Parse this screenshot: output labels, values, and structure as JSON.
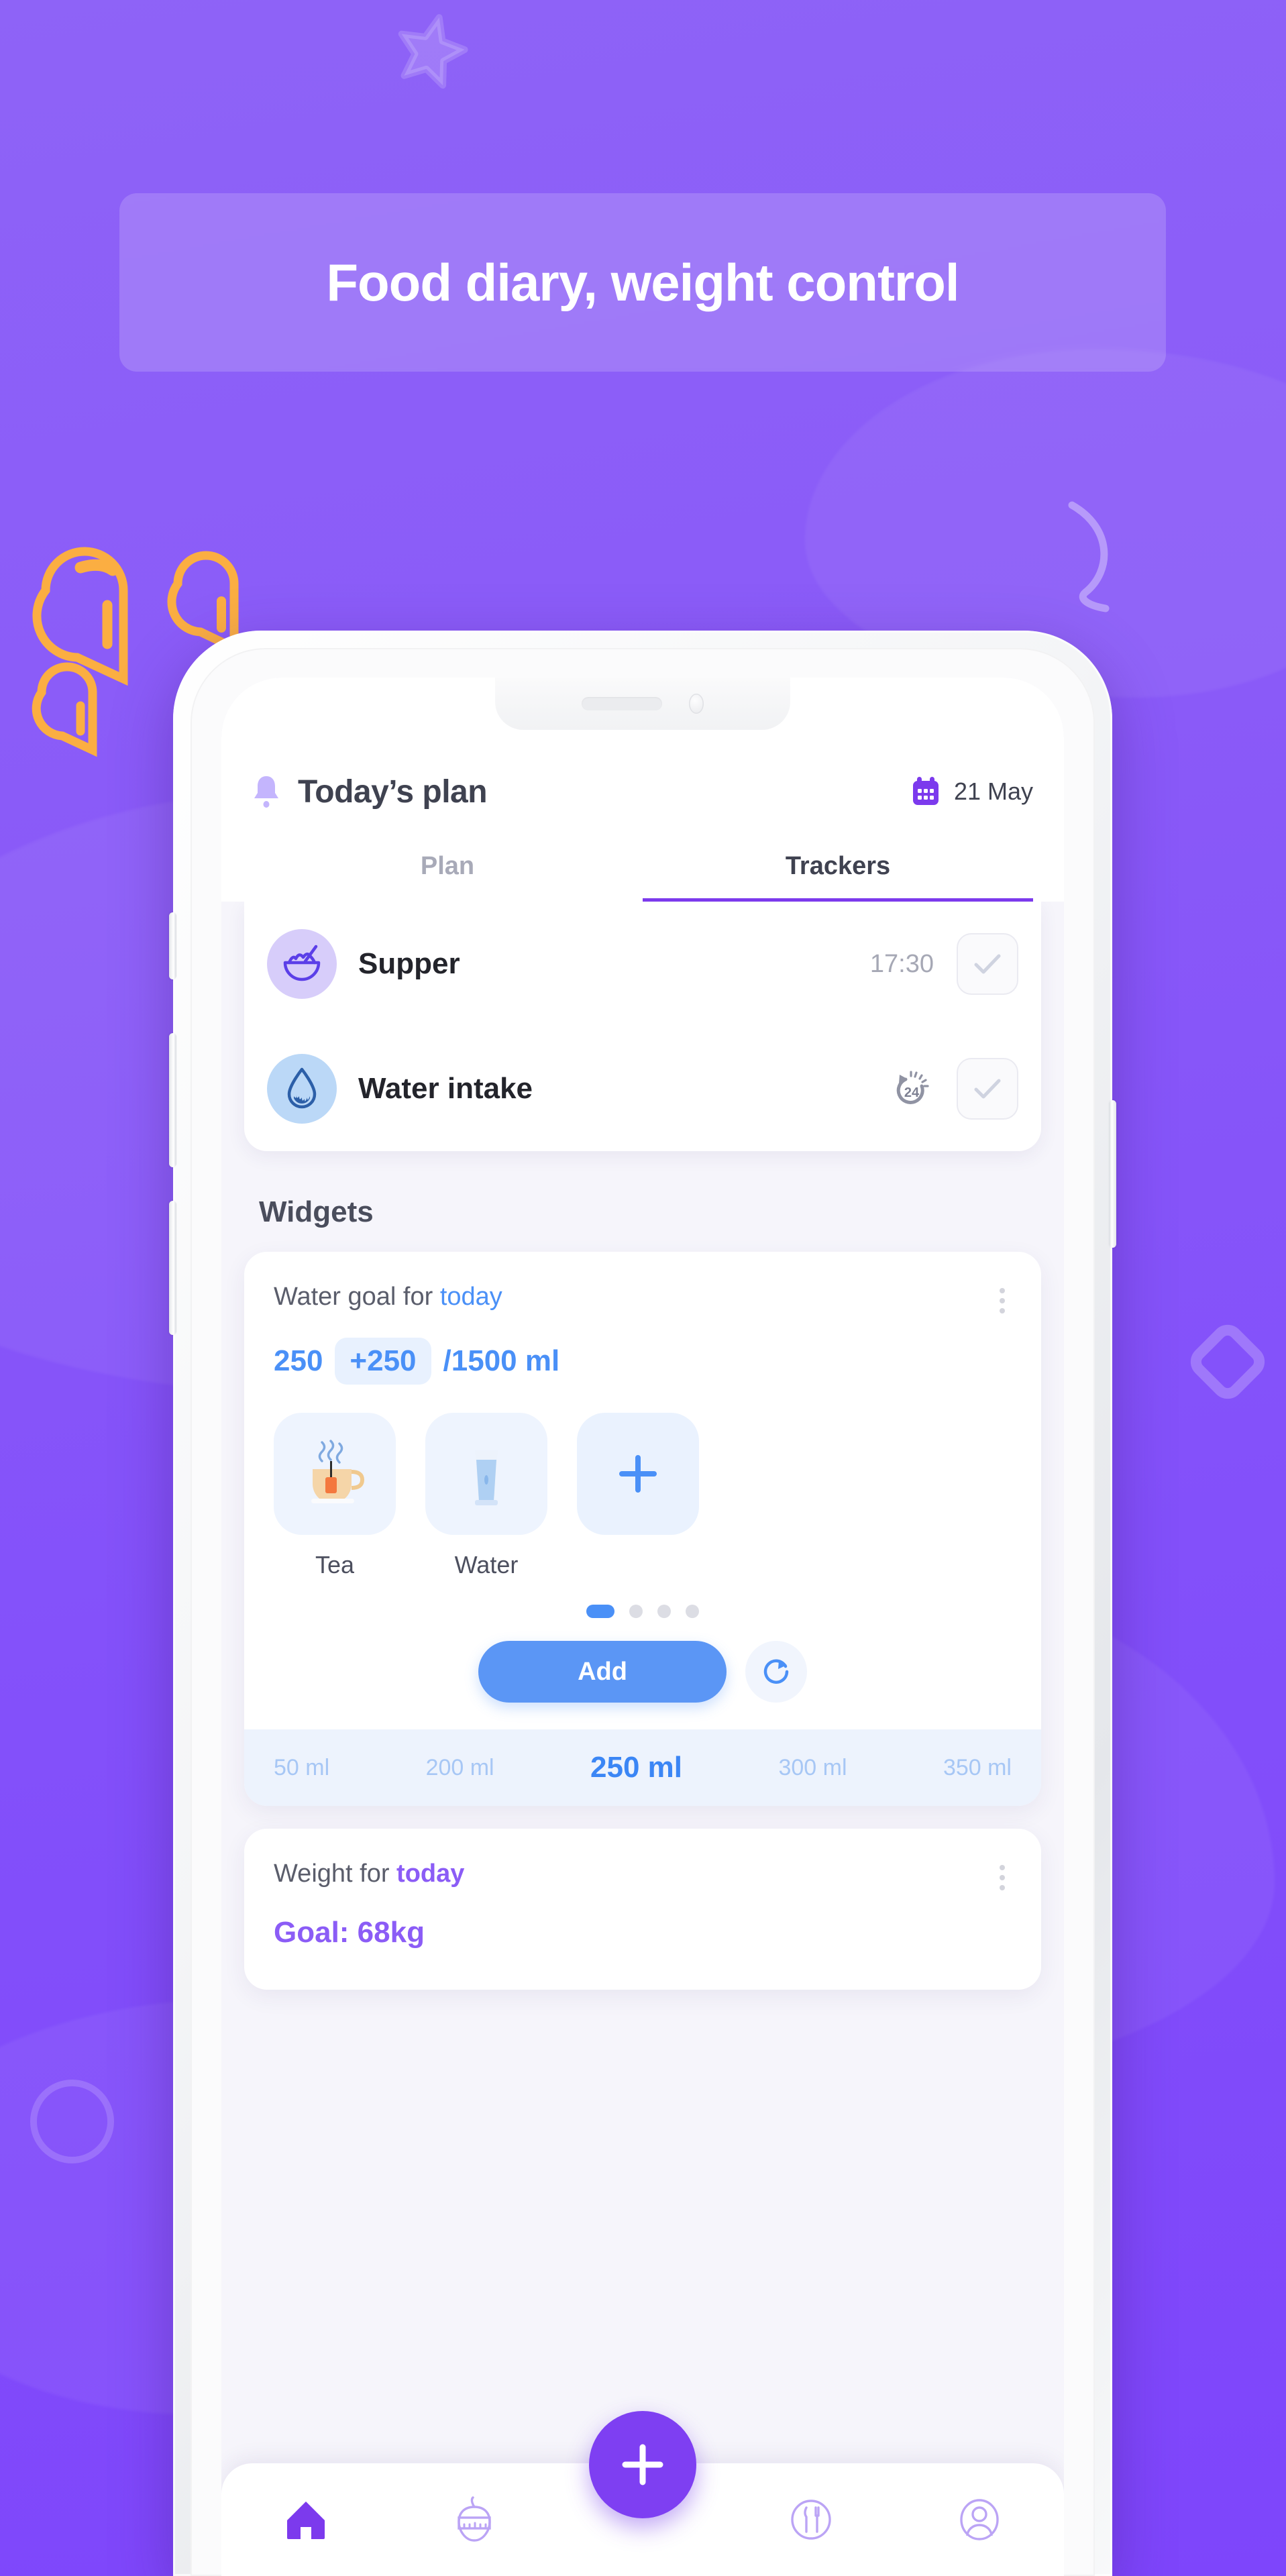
{
  "promo": {
    "headline": "Food diary, weight control",
    "background_color": "#8B5CF6",
    "banner_color": "rgba(255,255,255,0.17)",
    "accent_orange": "#FBAE42",
    "accent_purple": "#7C3AED"
  },
  "app": {
    "header": {
      "title": "Today’s plan",
      "bell_icon": "bell-icon",
      "calendar_icon": "calendar-icon",
      "date": "21 May"
    },
    "tabs": [
      {
        "label": "Plan",
        "active": false
      },
      {
        "label": "Trackers",
        "active": true
      }
    ],
    "trackers": [
      {
        "name": "Supper",
        "meta": "17:30",
        "icon": "bowl-icon",
        "icon_bg": "#D7CDFA",
        "checked": false
      },
      {
        "name": "Water intake",
        "meta": "",
        "meta_icon": "24h-timer-icon",
        "icon": "water-drop-icon",
        "icon_bg": "#BBD8F7",
        "checked": false
      }
    ],
    "widgets_section_title": "Widgets",
    "water_widget": {
      "title_prefix": "Water goal for ",
      "title_accent": "today",
      "current": "250",
      "increment": "+250",
      "total": "/1500 ml",
      "accent_color": "#4A90F7",
      "drinks": [
        {
          "label": "Tea",
          "icon": "teacup-icon"
        },
        {
          "label": "Water",
          "icon": "water-glass-icon"
        },
        {
          "label": "",
          "icon": "plus-icon"
        }
      ],
      "dots": {
        "count": 4,
        "active_index": 0
      },
      "add_button": "Add",
      "reset_icon": "refresh-icon",
      "volumes": [
        {
          "label": "50 ml",
          "selected": false
        },
        {
          "label": "200 ml",
          "selected": false
        },
        {
          "label": "250 ml",
          "selected": true
        },
        {
          "label": "300 ml",
          "selected": false
        },
        {
          "label": "350 ml",
          "selected": false
        }
      ]
    },
    "weight_widget": {
      "title_prefix": "Weight for ",
      "title_accent": "today",
      "goal": "Goal: 68kg",
      "accent_color": "#8B5CF6"
    },
    "bottom_nav": [
      {
        "icon": "home-icon",
        "active": true
      },
      {
        "icon": "apple-measure-icon",
        "active": false
      },
      {
        "icon": "plate-cutlery-icon",
        "active": false
      },
      {
        "icon": "profile-icon",
        "active": false
      }
    ],
    "fab_icon": "plus-icon"
  }
}
